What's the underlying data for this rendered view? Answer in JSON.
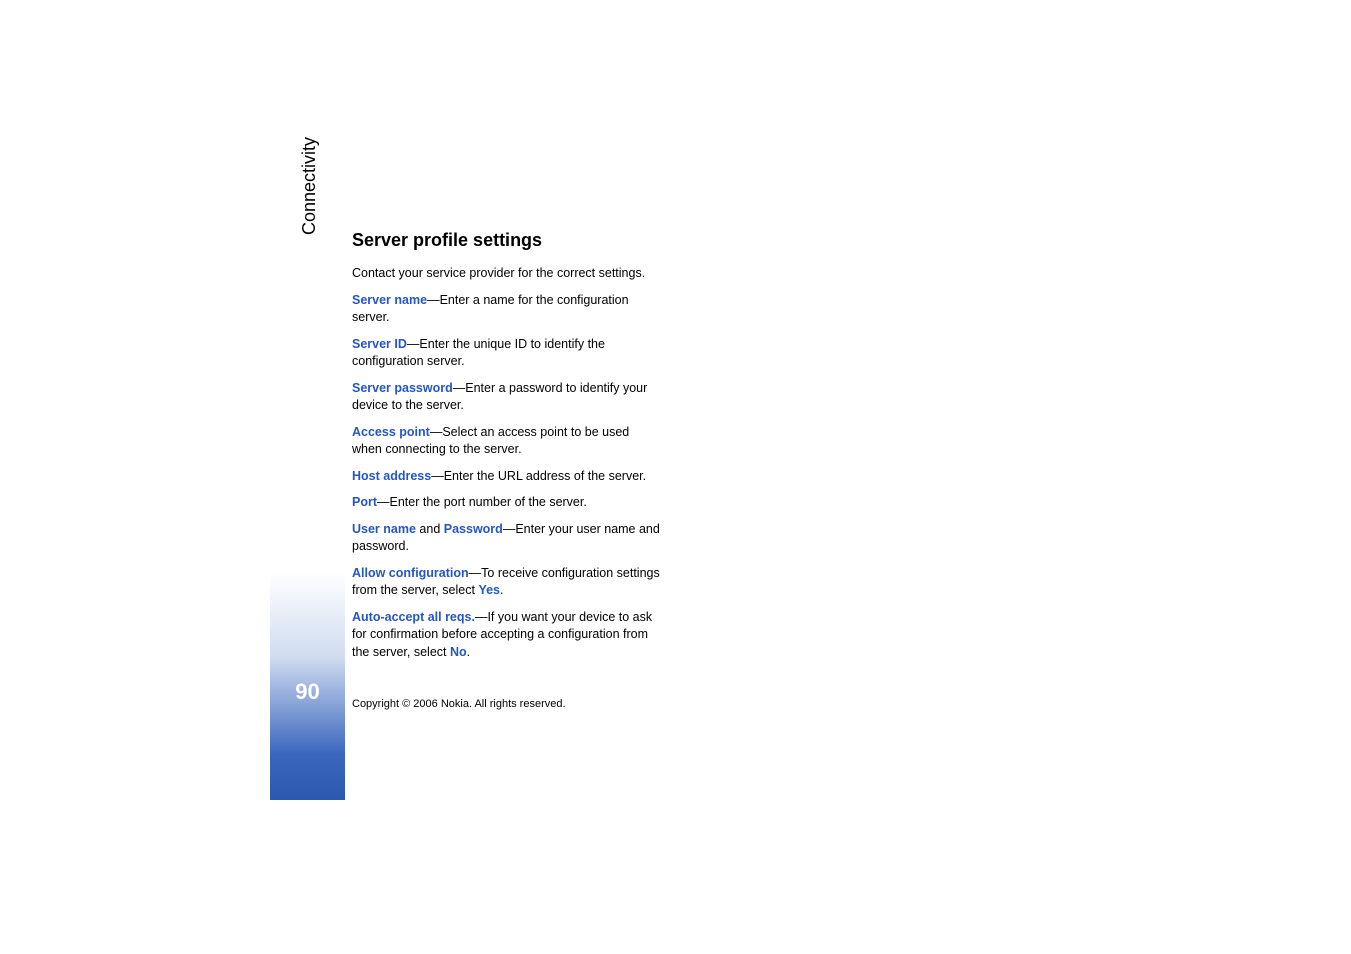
{
  "sidebar": {
    "label": "Connectivity",
    "page_number": "90"
  },
  "content": {
    "heading": "Server profile settings",
    "intro": "Contact your service provider for the correct settings.",
    "items": [
      {
        "term": "Server name",
        "desc": "—Enter a name for the configuration server."
      },
      {
        "term": "Server ID",
        "desc": "—Enter the unique ID to identify the configuration server."
      },
      {
        "term": "Server password",
        "desc": "—Enter a password to identify your device to the server."
      },
      {
        "term": "Access point",
        "desc": "—Select an access point to be used when connecting to the server."
      },
      {
        "term": "Host address",
        "desc": "—Enter the URL address of the server."
      },
      {
        "term": "Port",
        "desc": "—Enter the port number of the server."
      }
    ],
    "username_item": {
      "term1": "User name",
      "mid": " and ",
      "term2": "Password",
      "desc": "—Enter your user name and password."
    },
    "allow_config": {
      "term": "Allow configuration",
      "desc1": "—To receive configuration settings from the server, select ",
      "value": "Yes",
      "desc2": "."
    },
    "auto_accept": {
      "term": "Auto-accept all reqs.",
      "desc1": "—If you want your device to ask for confirmation before accepting a configuration from the server, select ",
      "value": "No",
      "desc2": "."
    }
  },
  "copyright": "Copyright © 2006 Nokia. All rights reserved."
}
